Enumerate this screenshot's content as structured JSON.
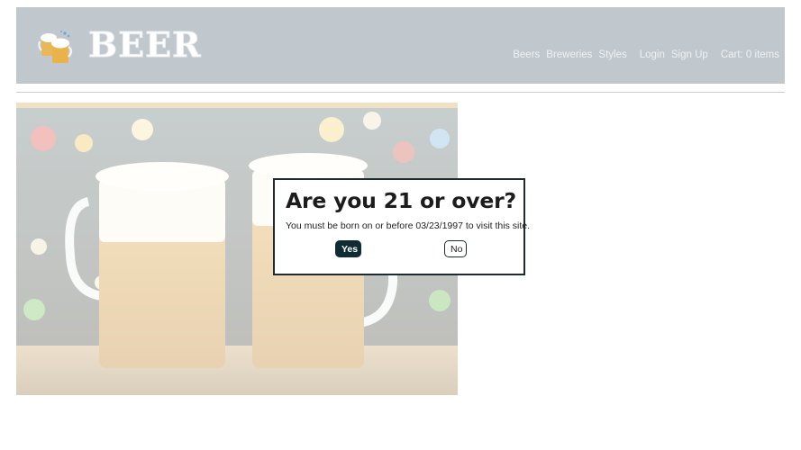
{
  "header": {
    "logo_text": "BEER",
    "logo_icon": "beer-mugs-icon",
    "background": "#c0c8ce"
  },
  "nav": {
    "beers": "Beers",
    "breweries": "Breweries",
    "styles": "Styles",
    "login": "Login",
    "signup": "Sign Up",
    "cart": "Cart: 0 items"
  },
  "hero": {
    "image": "two-beer-mugs-photo"
  },
  "modal": {
    "title": "Are you 21 or over?",
    "message": "You must be born on or before 03/23/1997 to visit this site.",
    "yes_label": "Yes",
    "no_label": "No",
    "yes_color": "#0f2b33"
  }
}
